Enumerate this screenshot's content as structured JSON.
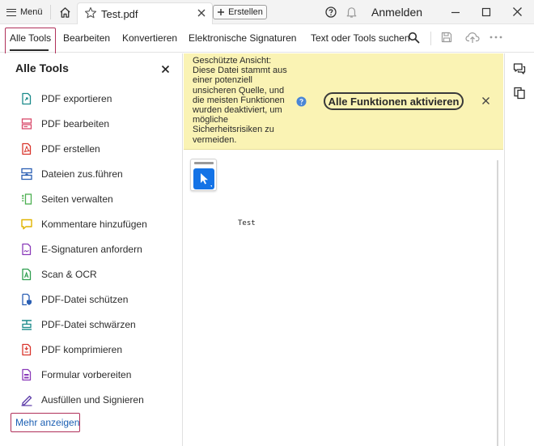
{
  "titlebar": {
    "menu_label": "Menü",
    "tab_title": "Test.pdf",
    "create_label": "Erstellen",
    "signin_label": "Anmelden"
  },
  "toolbar": {
    "tabs": [
      {
        "label": "Alle Tools",
        "active": true
      },
      {
        "label": "Bearbeiten"
      },
      {
        "label": "Konvertieren"
      },
      {
        "label": "Elektronische Signaturen"
      }
    ],
    "search_label": "Text oder Tools suchen"
  },
  "left_panel": {
    "title": "Alle Tools",
    "items": [
      {
        "label": "PDF exportieren",
        "icon": "export-pdf-icon",
        "color": "#1a8a8a"
      },
      {
        "label": "PDF bearbeiten",
        "icon": "edit-pdf-icon",
        "color": "#d94a6b"
      },
      {
        "label": "PDF erstellen",
        "icon": "create-pdf-icon",
        "color": "#d9342b"
      },
      {
        "label": "Dateien zus.führen",
        "icon": "combine-files-icon",
        "color": "#2b5fb3"
      },
      {
        "label": "Seiten verwalten",
        "icon": "organize-pages-icon",
        "color": "#4caf50"
      },
      {
        "label": "Kommentare hinzufügen",
        "icon": "comment-icon",
        "color": "#e0b400"
      },
      {
        "label": "E-Signaturen anfordern",
        "icon": "request-signature-icon",
        "color": "#8a3ab9"
      },
      {
        "label": "Scan & OCR",
        "icon": "scan-ocr-icon",
        "color": "#2e9e4f"
      },
      {
        "label": "PDF-Datei schützen",
        "icon": "protect-pdf-icon",
        "color": "#2b5fb3"
      },
      {
        "label": "PDF-Datei schwärzen",
        "icon": "redact-pdf-icon",
        "color": "#1a8a8a"
      },
      {
        "label": "PDF komprimieren",
        "icon": "compress-pdf-icon",
        "color": "#d9342b"
      },
      {
        "label": "Formular vorbereiten",
        "icon": "prepare-form-icon",
        "color": "#8a3ab9"
      },
      {
        "label": "Ausfüllen und Signieren",
        "icon": "fill-sign-icon",
        "color": "#5b3aa8"
      }
    ],
    "more_label": "Mehr anzeigen"
  },
  "notice": {
    "text": "Geschützte Ansicht: Diese Datei stammt aus einer potenziell unsicheren Quelle, und die meisten Funktionen wurden deaktiviert, um mögliche Sicherheitsrisiken zu vermeiden.",
    "button_label": "Alle Funktionen aktivieren",
    "background": "#faf3b4"
  },
  "document": {
    "text": "Test"
  },
  "colors": {
    "accent": "#1473e6",
    "highlight_box": "#b0305a",
    "link": "#1b5fb3"
  }
}
